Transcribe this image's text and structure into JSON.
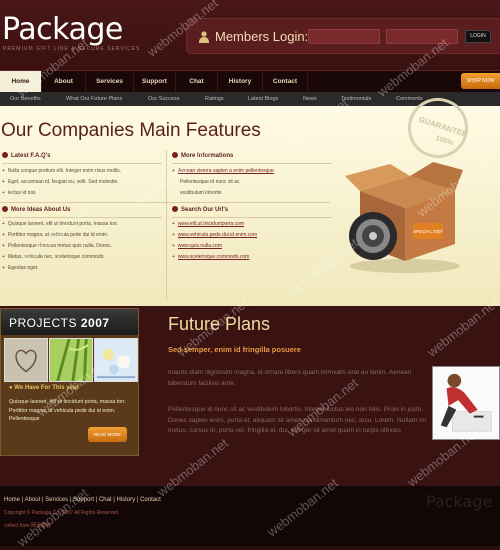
{
  "header": {
    "logo": "Package",
    "tagline": "PREMIUM GIFT LINE & SECURE SERVICES",
    "login_title": "Members Login:",
    "login_button": "LOGIN"
  },
  "nav": {
    "items": [
      "Home",
      "About",
      "Services",
      "Support",
      "Chat",
      "History",
      "Contact"
    ],
    "shop_button": "SHOP NOW"
  },
  "subnav": {
    "items": [
      "Our Benefits",
      "What Our Future Plans",
      "Our Success",
      "Ratings",
      "Latest Blogs",
      "News",
      "Testimonials",
      "Comments"
    ]
  },
  "features": {
    "title": "Our Companies Main Features",
    "stamp_text": "GUARANTEE",
    "stamp_pct": "100%",
    "box_label": "SPECIAL 2007",
    "latest": {
      "heading": "Latest F.A.Q's",
      "items": [
        "Nulla congue pretium elit. Integer enim risus mollis.",
        "Eget, accumsan id, feugiat eu, velit. Sed molestie.",
        "lectus id nisi."
      ]
    },
    "more_info": {
      "heading": "More Informations",
      "link": "Aenean viverra sapien a enim pellentesque",
      "lines": [
        "Pellentesque id nunc sit ac",
        "vestibulum lobortis"
      ]
    },
    "more_ideas": {
      "heading": "More Ideas About Us",
      "items": [
        "Quisque laoreet, elit ut tincidunt porta, massa torr.",
        "Porttitor magna, at vehicula pede dui id enim.",
        "Pellentesque rhoncus metus quis nulla. Donec.",
        "Metus, vehicula nec, scelerisque commodo",
        "Egestas eget."
      ]
    },
    "urls": {
      "heading": "Search Our Url's",
      "items": [
        "www.elit.ut.tinciduntporta.com",
        "www.vehicula.pede.dui.id.enim.com",
        "www.quis.nulla.com",
        "www.scelerisque.commodo.com"
      ]
    }
  },
  "projects": {
    "title": "PROJECTS",
    "year": "2007",
    "subtitle": "We Have For This year",
    "text": "Quisque laoreet, elit ut tincidunt porta, massa torr. Porttitor magna, at vehicula pede dui id enim. Pellentesque",
    "read_more": "READ MORE"
  },
  "future": {
    "title": "Future Plans",
    "subtitle": "Sed semper, enim id fringilla posuere",
    "p1": "mauris diam dignissim magna, id ornare libero quam immvalis erat eu lenim. Aenean bibendum facilisis ante.",
    "p2": "Pellentesque id nunc sit ac vestibulum lobortis. Integer luctus leo non felis. Proin in justo. Donec sapien enim, porta et, aliquam sit amet, condimentum nec, arcu. Lorem. Nullam mi metus, cursus in, porta vel, fringilla et, dui. Integer sit amet quam in turpis ultrices"
  },
  "footer": {
    "nav": "Home  |  About  |  Services  |  Support  |  Chat  |  History  |  Contact",
    "copyright": "Copyright © Package Co. 2007 All Rights Reserved",
    "collect": "collect from 网页模板",
    "logo": "Package"
  },
  "watermark": "webmoban.net",
  "colors": {
    "accent": "#e89a40",
    "brand": "#5a1e1e",
    "nav_active": "#f4f0d8"
  }
}
